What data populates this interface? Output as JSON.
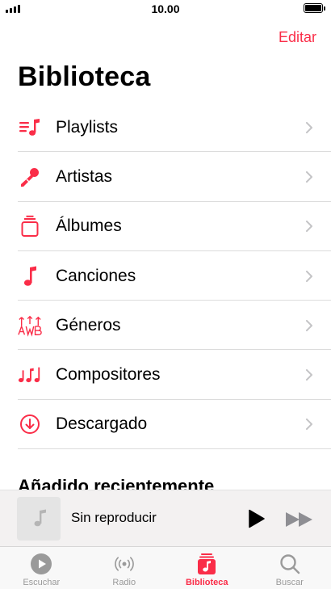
{
  "status_bar": {
    "time": "10.00"
  },
  "header": {
    "edit_label": "Editar",
    "title": "Biblioteca"
  },
  "menu": [
    {
      "label": "Playlists",
      "icon": "playlist-icon"
    },
    {
      "label": "Artistas",
      "icon": "microphone-icon"
    },
    {
      "label": "Álbumes",
      "icon": "album-stack-icon"
    },
    {
      "label": "Canciones",
      "icon": "music-note-icon"
    },
    {
      "label": "Géneros",
      "icon": "genres-icon"
    },
    {
      "label": "Compositores",
      "icon": "composers-icon"
    },
    {
      "label": "Descargado",
      "icon": "download-circle-icon"
    }
  ],
  "recent": {
    "title": "Añadido recientemente"
  },
  "player": {
    "title": "Sin reproducir"
  },
  "tabs": [
    {
      "label": "Escuchar",
      "icon": "play-circle-icon",
      "active": false
    },
    {
      "label": "Radio",
      "icon": "radio-icon",
      "active": false
    },
    {
      "label": "Biblioteca",
      "icon": "library-icon",
      "active": true
    },
    {
      "label": "Buscar",
      "icon": "search-icon",
      "active": false
    }
  ],
  "colors": {
    "accent": "#fa2d48",
    "inactive": "#9a9a9a",
    "separator": "#dcdcdc"
  }
}
